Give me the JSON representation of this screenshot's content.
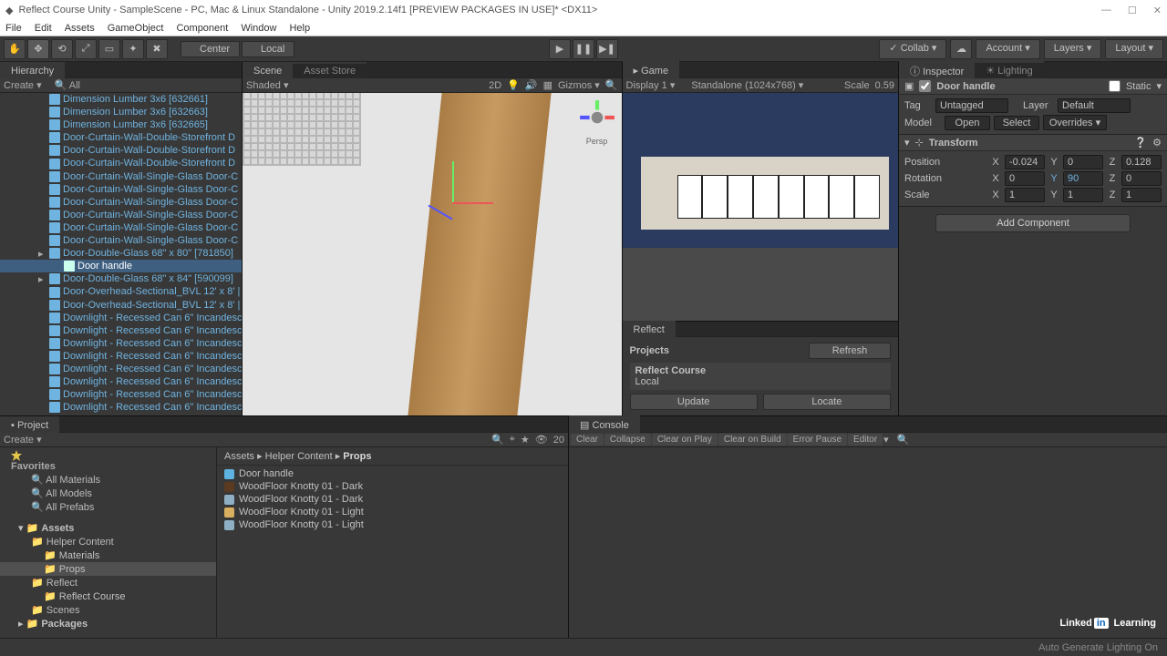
{
  "title": "Reflect Course Unity - SampleScene - PC, Mac & Linux Standalone - Unity 2019.2.14f1 [PREVIEW PACKAGES IN USE]* <DX11>",
  "menubar": [
    "File",
    "Edit",
    "Assets",
    "GameObject",
    "Component",
    "Window",
    "Help"
  ],
  "toolbar": {
    "center": "Center",
    "local": "Local",
    "collab": "Collab",
    "account": "Account",
    "layers": "Layers",
    "layout": "Layout"
  },
  "hierarchy": {
    "tab": "Hierarchy",
    "create": "Create",
    "items": [
      {
        "t": "Dimension Lumber 3x6 [632661]"
      },
      {
        "t": "Dimension Lumber 3x6 [632663]"
      },
      {
        "t": "Dimension Lumber 3x6 [632665]"
      },
      {
        "t": "Door-Curtain-Wall-Double-Storefront D"
      },
      {
        "t": "Door-Curtain-Wall-Double-Storefront D"
      },
      {
        "t": "Door-Curtain-Wall-Double-Storefront D"
      },
      {
        "t": "Door-Curtain-Wall-Single-Glass Door-C"
      },
      {
        "t": "Door-Curtain-Wall-Single-Glass Door-C"
      },
      {
        "t": "Door-Curtain-Wall-Single-Glass Door-C"
      },
      {
        "t": "Door-Curtain-Wall-Single-Glass Door-C"
      },
      {
        "t": "Door-Curtain-Wall-Single-Glass Door-C"
      },
      {
        "t": "Door-Curtain-Wall-Single-Glass Door-C"
      },
      {
        "t": "Door-Double-Glass 68\" x 80\" [781850]",
        "fold": true
      },
      {
        "t": "Door handle",
        "sel": true
      },
      {
        "t": "Door-Double-Glass 68\" x 84\" [590099]",
        "fold": true
      },
      {
        "t": "Door-Overhead-Sectional_BVL 12' x 8' |"
      },
      {
        "t": "Door-Overhead-Sectional_BVL 12' x 8' |"
      },
      {
        "t": "Downlight - Recessed Can 6\" Incandesc"
      },
      {
        "t": "Downlight - Recessed Can 6\" Incandesc"
      },
      {
        "t": "Downlight - Recessed Can 6\" Incandesc"
      },
      {
        "t": "Downlight - Recessed Can 6\" Incandesc"
      },
      {
        "t": "Downlight - Recessed Can 6\" Incandesc"
      },
      {
        "t": "Downlight - Recessed Can 6\" Incandesc"
      },
      {
        "t": "Downlight - Recessed Can 6\" Incandesc"
      },
      {
        "t": "Downlight - Recessed Can 6\" Incandesc"
      }
    ]
  },
  "scene": {
    "tab_scene": "Scene",
    "tab_store": "Asset Store",
    "shading": "Shaded",
    "mode": "2D",
    "gizmos": "Gizmos",
    "persp": "Persp"
  },
  "game": {
    "tab": "Game",
    "display": "Display 1",
    "aspect": "Standalone (1024x768)",
    "scale": "Scale",
    "scale_val": "0.59"
  },
  "reflect": {
    "tab": "Reflect",
    "projects": "Projects",
    "refresh": "Refresh",
    "course": "Reflect Course",
    "local": "Local",
    "update": "Update",
    "locate": "Locate"
  },
  "inspector": {
    "tab_insp": "Inspector",
    "tab_light": "Lighting",
    "name": "Door handle",
    "static": "Static",
    "tag_l": "Tag",
    "tag_v": "Untagged",
    "layer_l": "Layer",
    "layer_v": "Default",
    "model": "Model",
    "open": "Open",
    "select": "Select",
    "overrides": "Overrides",
    "transform": "Transform",
    "pos": "Position",
    "rot": "Rotation",
    "scl": "Scale",
    "px": "-0.024",
    "py": "0",
    "pz": "0.128",
    "rx": "0",
    "ry": "90",
    "rz": "0",
    "sx": "1",
    "sy": "1",
    "sz": "1",
    "add": "Add Component"
  },
  "project": {
    "tab": "Project",
    "create": "Create",
    "fav": "Favorites",
    "fav_items": [
      "All Materials",
      "All Models",
      "All Prefabs"
    ],
    "assets": "Assets",
    "tree": [
      {
        "t": "Helper Content",
        "d": 1
      },
      {
        "t": "Materials",
        "d": 2
      },
      {
        "t": "Props",
        "d": 2,
        "sel": true
      },
      {
        "t": "Reflect",
        "d": 1
      },
      {
        "t": "Reflect Course",
        "d": 2
      },
      {
        "t": "Scenes",
        "d": 1
      }
    ],
    "packages": "Packages",
    "crumb": [
      "Assets",
      "Helper Content",
      "Props"
    ],
    "files": [
      {
        "t": "Door handle",
        "c": "#5fb3e0"
      },
      {
        "t": "WoodFloor Knotty 01 - Dark",
        "c": "#5a3a20"
      },
      {
        "t": "WoodFloor Knotty 01 - Dark",
        "c": "#8fb0c4"
      },
      {
        "t": "WoodFloor Knotty 01 - Light",
        "c": "#d8b060"
      },
      {
        "t": "WoodFloor Knotty 01 - Light",
        "c": "#8fb0c4"
      }
    ],
    "count": "20"
  },
  "console": {
    "tab": "Console",
    "btns": [
      "Clear",
      "Collapse",
      "Clear on Play",
      "Clear on Build",
      "Error Pause",
      "Editor"
    ]
  },
  "footer": "Auto Generate Lighting On",
  "branding": {
    "a": "Linked",
    "b": "in",
    "c": "Learning"
  }
}
